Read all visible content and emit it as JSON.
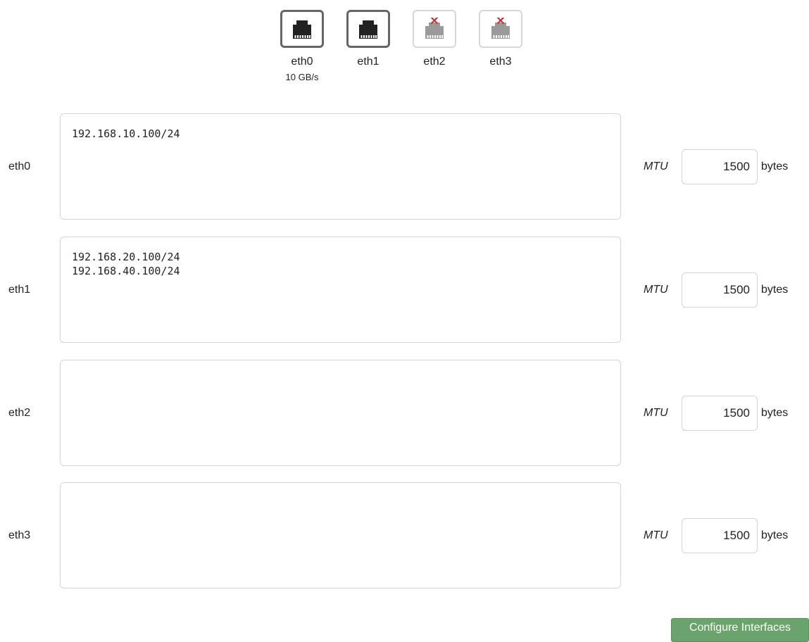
{
  "ports": [
    {
      "name": "eth0",
      "speed": "10 GB/s",
      "status": "up",
      "icon": "ethernet-port-icon"
    },
    {
      "name": "eth1",
      "speed": "",
      "status": "up",
      "icon": "ethernet-port-icon"
    },
    {
      "name": "eth2",
      "speed": "",
      "status": "down",
      "icon": "ethernet-port-disconnected-icon"
    },
    {
      "name": "eth3",
      "speed": "",
      "status": "down",
      "icon": "ethernet-port-disconnected-icon"
    }
  ],
  "interfaces": [
    {
      "name": "eth0",
      "addresses": "192.168.10.100/24",
      "mtu_label": "MTU",
      "mtu": "1500",
      "mtu_unit": "bytes"
    },
    {
      "name": "eth1",
      "addresses": "192.168.20.100/24\n192.168.40.100/24",
      "mtu_label": "MTU",
      "mtu": "1500",
      "mtu_unit": "bytes"
    },
    {
      "name": "eth2",
      "addresses": "",
      "mtu_label": "MTU",
      "mtu": "1500",
      "mtu_unit": "bytes"
    },
    {
      "name": "eth3",
      "addresses": "",
      "mtu_label": "MTU",
      "mtu": "1500",
      "mtu_unit": "bytes"
    }
  ],
  "actions": {
    "configure_label": "Configure Interfaces"
  },
  "colors": {
    "port_up": "#222222",
    "port_down": "#9a9a9a",
    "port_down_mark": "#d03030",
    "button_bg": "#6aa36b"
  }
}
